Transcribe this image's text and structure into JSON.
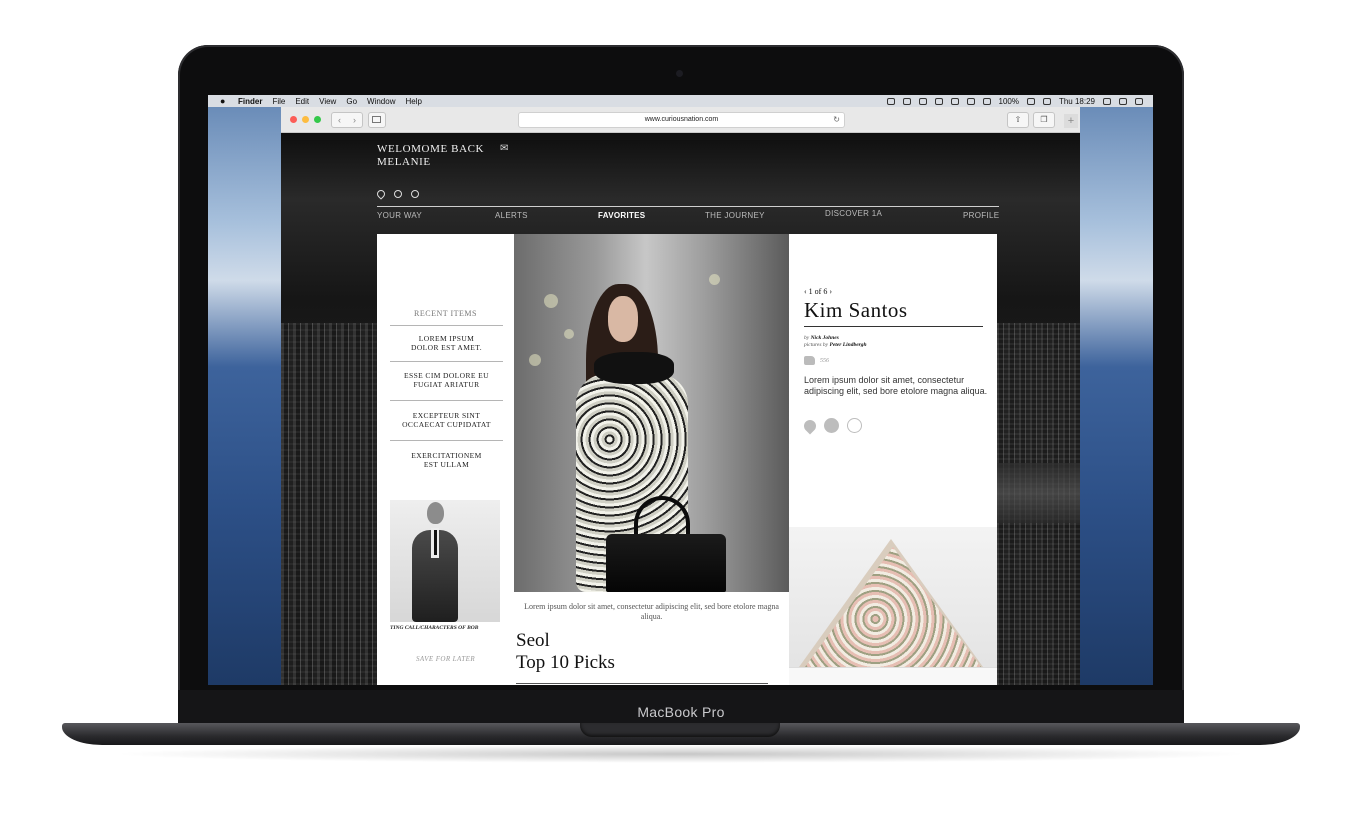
{
  "device": {
    "label": "MacBook Pro"
  },
  "menubar": {
    "apple": "",
    "items": [
      "Finder",
      "File",
      "Edit",
      "View",
      "Go",
      "Window",
      "Help"
    ],
    "battery": "100%",
    "clock": "Thu 18:29"
  },
  "browser": {
    "url": "www.curiousnation.com",
    "back": "‹",
    "forward": "›",
    "reload": "↻",
    "new_tab": "+"
  },
  "site": {
    "welcome": "WELOMOME BACK\nMELANIE",
    "nav": [
      "YOUR WAY",
      "ALERTS",
      "FAVORITES",
      "THE JOURNEY",
      "DISCOVER 1A",
      "PROFILE"
    ],
    "active_nav": "FAVORITES",
    "recent": {
      "title": "RECENT ITEMS",
      "items": [
        "LOREM IPSUM\nDOLOR EST AMET.",
        "ESSE CIM DOLORE EU\nFUGIAT ARIATUR",
        "EXCEPTEUR SINT\nOCCAECAT CUPIDATAT",
        "EXERCITATIONEM\nEST ULLAM"
      ],
      "photo_caption": "TING CALL/CHARACTERS OF BOB",
      "save_later": "SAVE FOR LATER"
    },
    "feature": {
      "text": "Lorem ipsum dolor sit amet, consectetur adipiscing elit, sed bore etolore magna aliqua.",
      "title": "Seol\nTop 10 Picks"
    },
    "profile": {
      "pager": "‹  1 of 6  ›",
      "name": "Kim Santos",
      "by_prefix": "by",
      "author": "Nick Johnes",
      "pictures_prefix": "pictures by",
      "photographer": "Peter Lindbergh",
      "likes": "556",
      "description": "Lorem ipsum dolor sit amet, consectetur adipiscing elit, sed bore etolore magna aliqua."
    }
  }
}
